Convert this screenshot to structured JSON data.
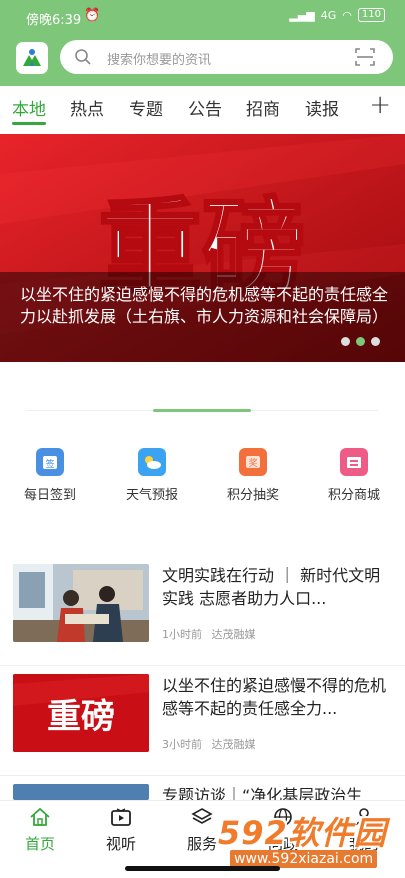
{
  "status": {
    "time": "傍晚6:39",
    "signal": "4G",
    "battery": "110"
  },
  "search": {
    "placeholder": "搜索你想要的资讯"
  },
  "tabs": [
    {
      "label": "本地",
      "active": true
    },
    {
      "label": "热点"
    },
    {
      "label": "专题"
    },
    {
      "label": "公告"
    },
    {
      "label": "招商"
    },
    {
      "label": "读报"
    }
  ],
  "banner": {
    "headline_art": "重磅",
    "caption": "以坐不住的紧迫感慢不得的危机感等不起的责任感全力以赴抓发展（土右旗、市人力资源和社会保障局）",
    "slide_count": 3,
    "active_slide": 2
  },
  "quick_links": [
    {
      "label": "每日签到",
      "icon": "calendar-sign-icon",
      "color": "#4a90e2"
    },
    {
      "label": "天气预报",
      "icon": "weather-icon",
      "color": "#3ba3f0"
    },
    {
      "label": "积分抽奖",
      "icon": "lottery-icon",
      "color": "#f36f3c"
    },
    {
      "label": "积分商城",
      "icon": "shop-icon",
      "color": "#ef5b87"
    }
  ],
  "news": [
    {
      "title": "文明实践在行动 ｜ 新时代文明实践  志愿者助力人口...",
      "time": "1小时前",
      "source": "达茂融媒"
    },
    {
      "title": "以坐不住的紧迫感慢不得的危机感等不起的责任感全力...",
      "time": "3小时前",
      "source": "达茂融媒",
      "thumb_text": "重磅"
    },
    {
      "title": "专题访谈｜“净化基层政治生"
    }
  ],
  "bottom_nav": [
    {
      "label": "首页",
      "active": true
    },
    {
      "label": "视听"
    },
    {
      "label": "服务"
    },
    {
      "label": "问政"
    },
    {
      "label": "我的"
    }
  ],
  "watermark": {
    "brand": "592软件园",
    "url": "www.592xiazai.com"
  },
  "colors": {
    "brand_green": "#7dc67a",
    "active_green": "#35a83c",
    "banner_red": "#d81519"
  }
}
